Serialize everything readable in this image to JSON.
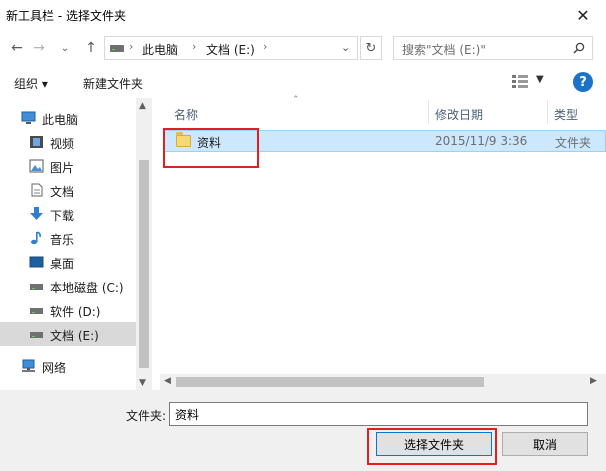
{
  "window": {
    "title": "新工具栏 - 选择文件夹"
  },
  "navigation": {
    "breadcrumbs": [
      "此电脑",
      "文档 (E:)"
    ],
    "search_placeholder": "搜索\"文档 (E:)\""
  },
  "toolbar": {
    "organize": "组织 ▾",
    "new_folder": "新建文件夹"
  },
  "sidebar": {
    "items": [
      {
        "label": "此电脑",
        "icon": "computer-icon"
      },
      {
        "label": "视频",
        "icon": "video-icon"
      },
      {
        "label": "图片",
        "icon": "pictures-icon"
      },
      {
        "label": "文档",
        "icon": "documents-icon"
      },
      {
        "label": "下载",
        "icon": "download-icon"
      },
      {
        "label": "音乐",
        "icon": "music-icon"
      },
      {
        "label": "桌面",
        "icon": "desktop-icon"
      },
      {
        "label": "本地磁盘 (C:)",
        "icon": "drive-icon"
      },
      {
        "label": "软件 (D:)",
        "icon": "drive-icon"
      },
      {
        "label": "文档 (E:)",
        "icon": "drive-icon",
        "selected": true
      },
      {
        "label": "网络",
        "icon": "network-icon"
      }
    ]
  },
  "file_list": {
    "columns": [
      "名称",
      "修改日期",
      "类型"
    ],
    "rows": [
      {
        "name": "资料",
        "modified": "2015/11/9 3:36",
        "type": "文件夹",
        "icon": "folder-icon",
        "selected": true
      }
    ]
  },
  "footer": {
    "folder_label": "文件夹:",
    "folder_value": "资料",
    "select_button": "选择文件夹",
    "cancel_button": "取消"
  },
  "colors": {
    "selection": "#cce8ff",
    "selection_border": "#99d1ff",
    "highlight_annotation": "#e02020",
    "accent": "#0078d7"
  }
}
